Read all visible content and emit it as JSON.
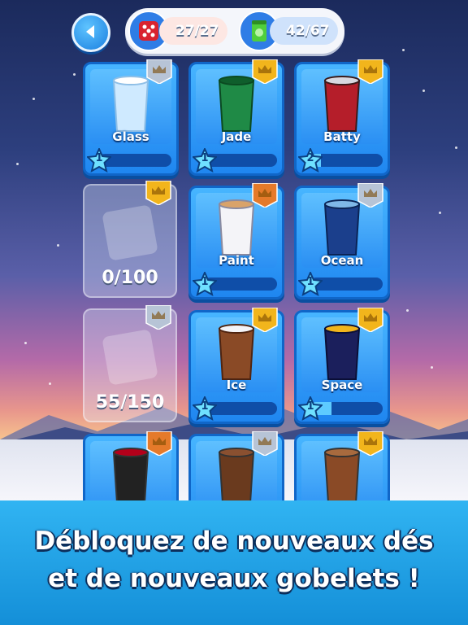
{
  "header": {
    "dice_count": "27/27",
    "cups_count": "42/67",
    "icons": {
      "back": "back-arrow-icon",
      "dice": "dice-icon",
      "cups": "cup-collection-icon"
    }
  },
  "cards": [
    {
      "name": "Glass",
      "level": "1",
      "progress": 0.0,
      "ribbon": "silver"
    },
    {
      "name": "Jade",
      "level": "1",
      "progress": 0.0,
      "ribbon": "gold"
    },
    {
      "name": "Batty",
      "level": "2",
      "progress": 0.15,
      "ribbon": "gold"
    },
    {
      "locked": true,
      "progress_text": "0/100",
      "ribbon": "gold"
    },
    {
      "name": "Paint",
      "level": "1",
      "progress": 0.0,
      "ribbon": "bronze"
    },
    {
      "name": "Ocean",
      "level": "1",
      "progress": 0.0,
      "ribbon": "silver"
    },
    {
      "locked": true,
      "progress_text": "55/150",
      "ribbon": "silver"
    },
    {
      "name": "Ice",
      "level": "1",
      "progress": 0.0,
      "ribbon": "gold"
    },
    {
      "name": "Space",
      "level": "1",
      "progress": 0.3,
      "ribbon": "gold"
    },
    {
      "ribbon": "bronze"
    },
    {
      "ribbon": "silver"
    },
    {
      "ribbon": "gold"
    }
  ],
  "banner": {
    "line1": "Débloquez de nouveaux dés",
    "line2": "et de nouveaux gobelets !"
  },
  "colors": {
    "gold": "#f2b51c",
    "silver": "#b7c4d6",
    "bronze": "#e57a2a",
    "accent": "#1f86f0"
  }
}
